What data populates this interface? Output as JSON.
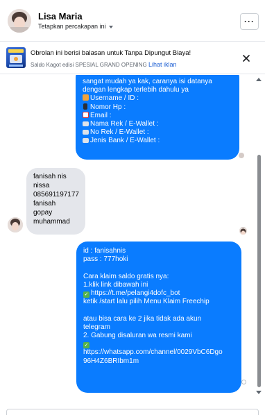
{
  "header": {
    "contact_name": "Lisa Maria",
    "subtitle": "Tetapkan percakapan ini",
    "more_label": "···"
  },
  "banner": {
    "title": "Obrolan ini berisi balasan untuk Tanpa Dipungut Biaya!",
    "subtitle": "Saldo Kagot edisi SPESIAL GRAND OPENING",
    "link": "Lihat iklan",
    "close_label": "×"
  },
  "messages": {
    "m1": {
      "lines": [
        "sangat mudah ya kak, caranya isi datanya",
        "dengan lengkap terlebih dahulu ya",
        "Username / ID :",
        "Nomor Hp :",
        "Email :",
        "Nama Rek / E-Wallet :",
        "No Rek / E-Wallet :",
        "Jenis Bank / E-Wallet :"
      ]
    },
    "m2": {
      "lines": [
        "fanisah nis",
        "nissa",
        "085691197177",
        "fanisah",
        "gopay",
        "muhammad"
      ]
    },
    "m3": {
      "lines": [
        "id : fanisahnis",
        "pass : 777hoki",
        "",
        "Cara klaim saldo gratis nya:",
        "1.klik link dibawah ini",
        "https://t.me/pelangi4dofc_bot",
        "ketik /start lalu pilih Menu Klaim Freechip",
        "",
        "atau bisa cara ke 2 jika tidak ada akun",
        "telegram",
        "2. Gabung disaluran wa resmi kami",
        "",
        "https://whatsapp.com/channel/0029VbC6Dgo",
        "96H4Z6BRIbm1m"
      ]
    }
  },
  "icons": {
    "numbers": "input-numbers-icon",
    "phone": "mobile-phone-icon",
    "mail": "envelope-icon",
    "card": "credit-card-icon",
    "check": "check-mark-button-icon"
  },
  "colors": {
    "outgoing_bubble": "#0a7cff",
    "incoming_bubble": "#e4e6eb",
    "link": "#1d5fd3"
  }
}
